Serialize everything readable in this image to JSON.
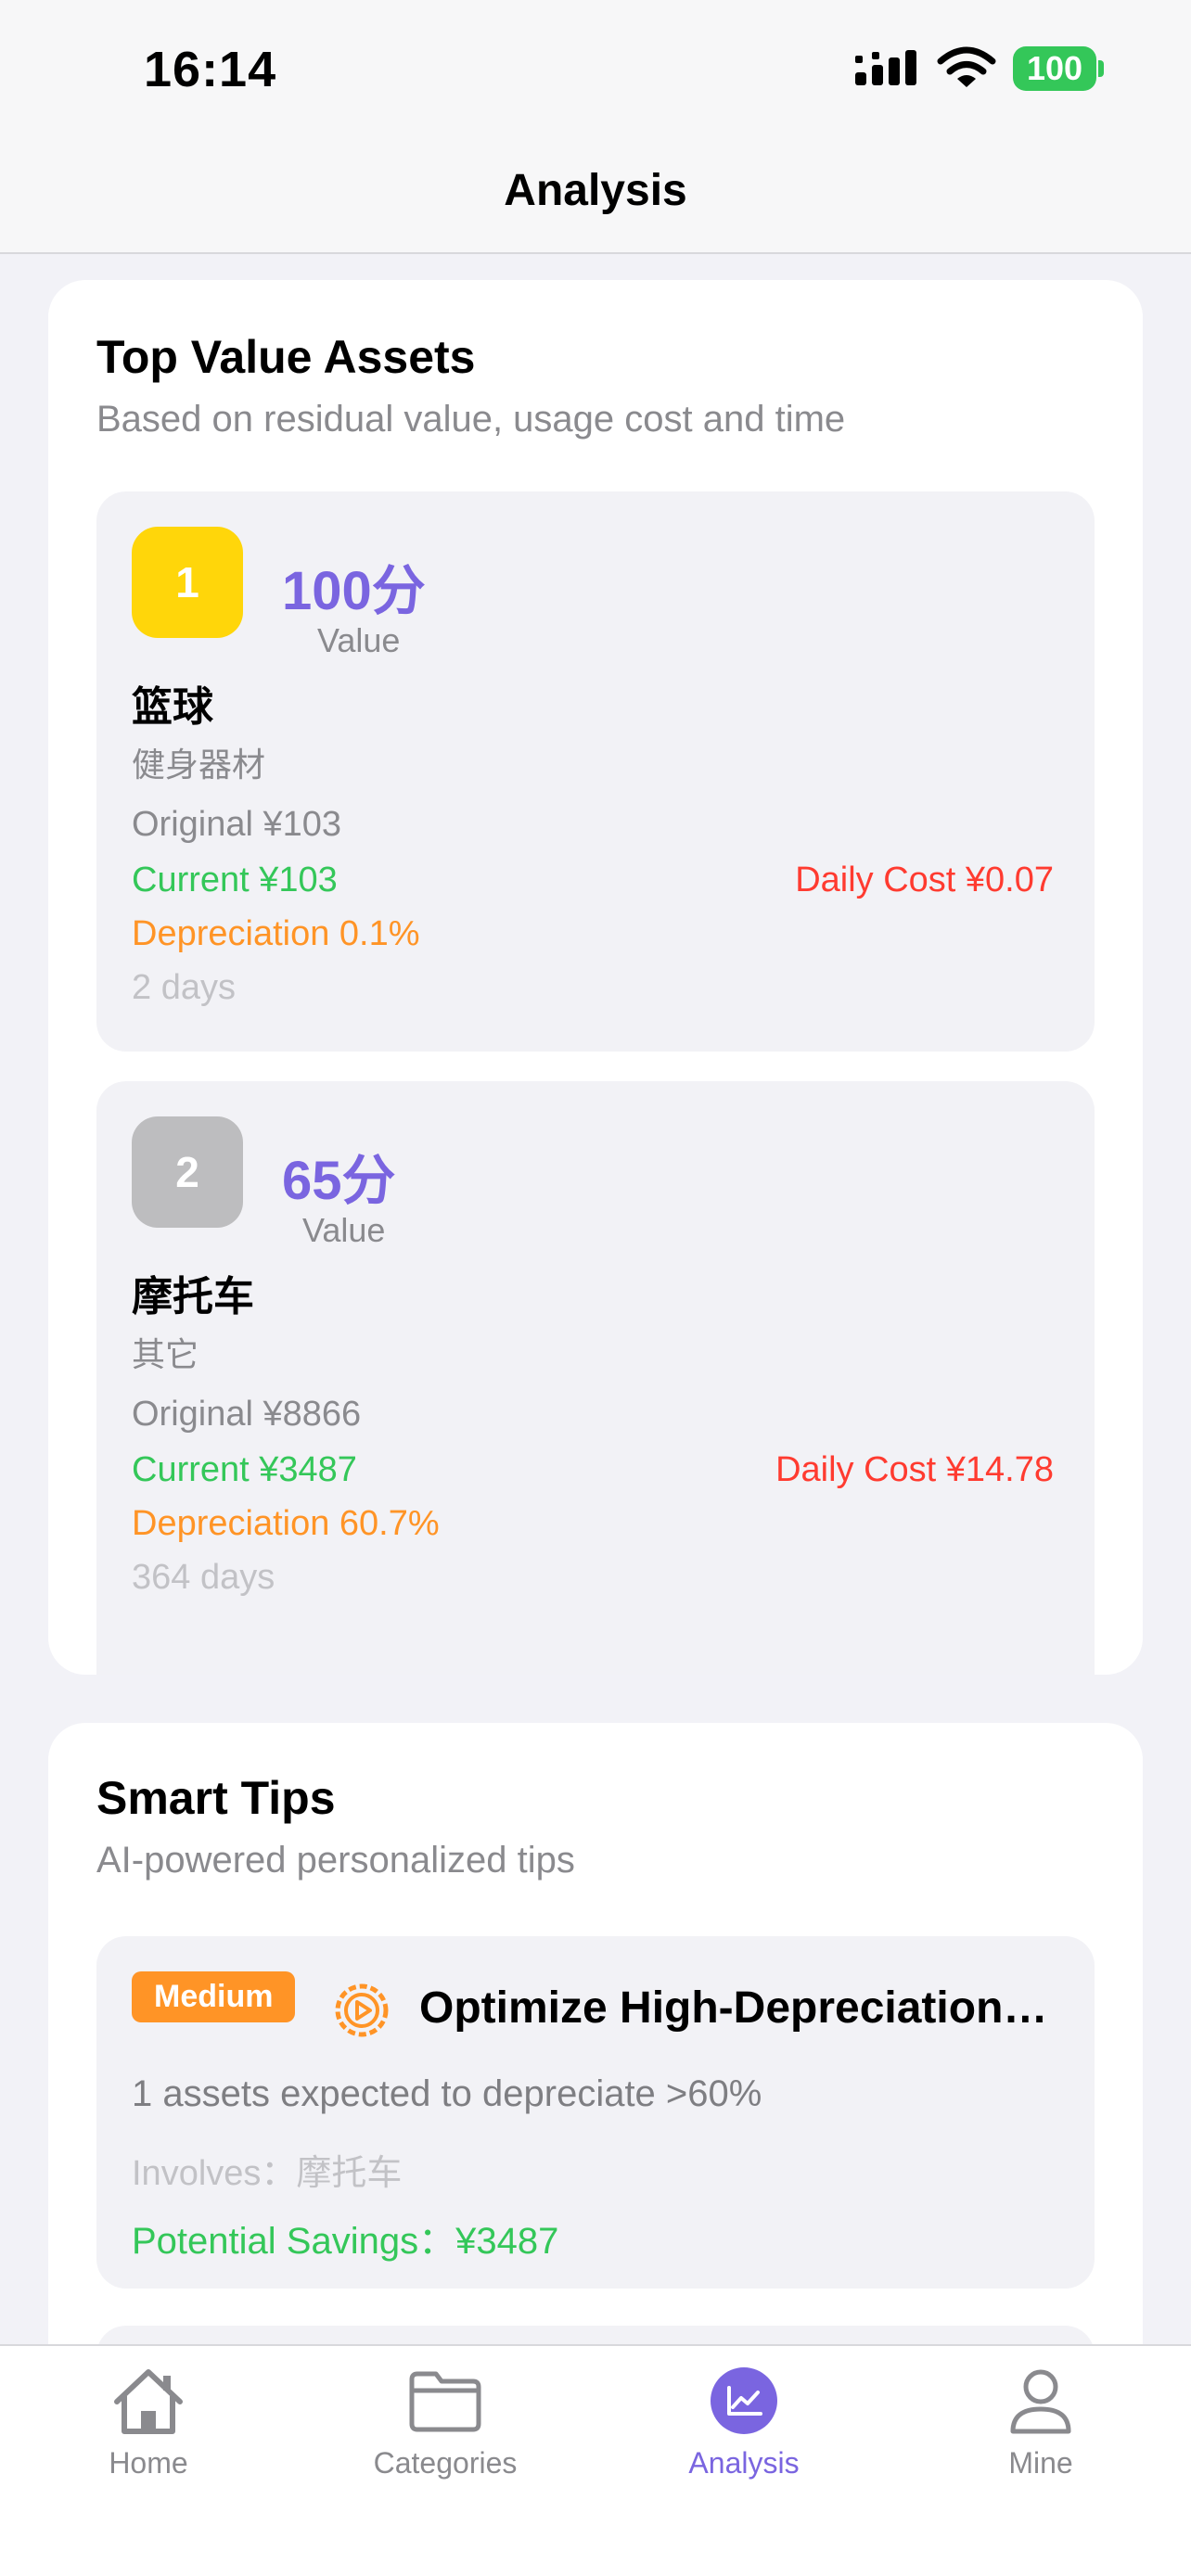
{
  "status": {
    "time": "16:14",
    "battery": "100"
  },
  "nav": {
    "title": "Analysis"
  },
  "top_assets": {
    "title": "Top Value Assets",
    "subtitle": "Based on residual value, usage cost and time",
    "items": [
      {
        "rank": "1",
        "rank_color": "#ffd60a",
        "score": "100分",
        "score_label": "Value",
        "name": "篮球",
        "category": "健身器材",
        "original": "Original ¥103",
        "current": "Current ¥103",
        "depreciation": "Depreciation 0.1%",
        "days": "2 days",
        "daily_cost": "Daily Cost ¥0.07"
      },
      {
        "rank": "2",
        "rank_color": "#bdbdbf",
        "score": "65分",
        "score_label": "Value",
        "name": "摩托车",
        "category": "其它",
        "original": "Original ¥8866",
        "current": "Current ¥3487",
        "depreciation": "Depreciation 60.7%",
        "days": "364 days",
        "daily_cost": "Daily Cost ¥14.78"
      }
    ]
  },
  "smart_tips": {
    "title": "Smart Tips",
    "subtitle": "AI-powered personalized tips",
    "items": [
      {
        "badge": "Medium",
        "icon": "gear-play-icon",
        "title": "Optimize High-Depreciation…",
        "description": "1 assets expected to depreciate >60%",
        "involves": "Involves：摩托车",
        "savings": "Potential Savings：¥3487"
      }
    ]
  },
  "tab_bar": {
    "tabs": [
      {
        "label": "Home",
        "icon": "home-icon"
      },
      {
        "label": "Categories",
        "icon": "folder-icon"
      },
      {
        "label": "Analysis",
        "icon": "chart-icon",
        "active": true
      },
      {
        "label": "Mine",
        "icon": "person-icon"
      }
    ]
  },
  "colors": {
    "accent": "#7a65e0",
    "green": "#34c759",
    "orange": "#ff9426",
    "red": "#ff3b30"
  }
}
